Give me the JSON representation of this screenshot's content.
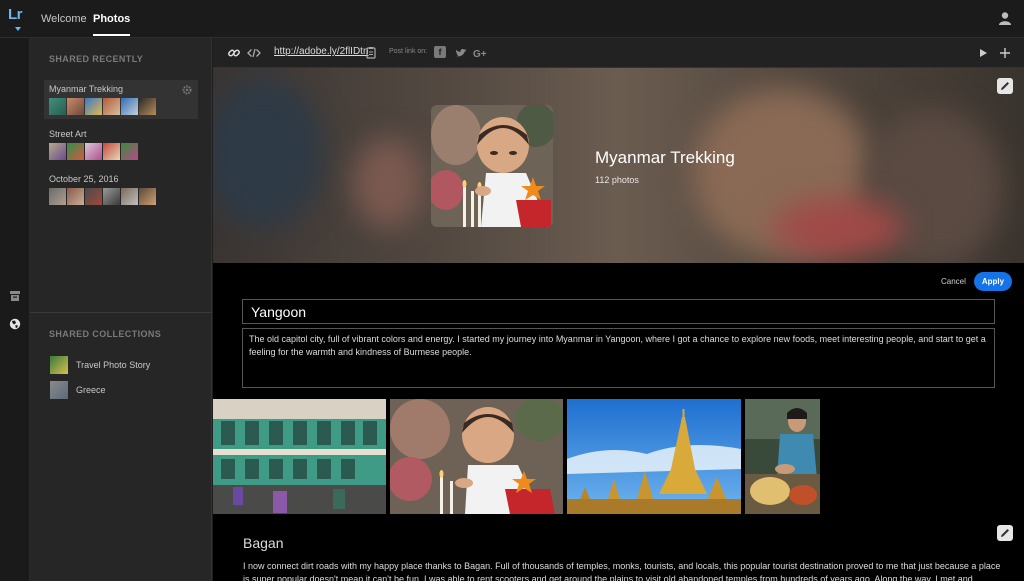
{
  "app": {
    "logo": "Lr"
  },
  "nav": {
    "tabs": [
      {
        "label": "Welcome"
      },
      {
        "label": "Photos"
      }
    ]
  },
  "sidebar": {
    "shared_recently_title": "SHARED RECENTLY",
    "albums": [
      {
        "name": "Myanmar Trekking",
        "selected": true
      },
      {
        "name": "Street Art"
      },
      {
        "name": "October 25, 2016"
      }
    ],
    "shared_collections_title": "SHARED COLLECTIONS",
    "collections": [
      {
        "name": "Travel Photo Story"
      },
      {
        "name": "Greece"
      }
    ]
  },
  "linkbar": {
    "url": "http://adobe.ly/2flIDtn",
    "post_label": "Post link on:",
    "icons": [
      "link-icon",
      "embed-code-icon",
      "copy-icon",
      "facebook-icon",
      "twitter-icon",
      "google-plus-icon",
      "play-icon",
      "add-icon"
    ]
  },
  "hero": {
    "title": "Myanmar Trekking",
    "photo_count": "112 photos"
  },
  "editor": {
    "cancel_label": "Cancel",
    "apply_label": "Apply",
    "title_value": "Yangoon",
    "body_value": "The old capitol city, full of vibrant colors and energy. I started my journey into Myanmar in Yangoon, where I got a chance to explore new foods, meet interesting people, and start to get a feeling for the warmth and kindness of Burmese people."
  },
  "section2": {
    "title": "Bagan",
    "body": "I now connect dirt roads with my happy place thanks to Bagan. Full of thousands of temples, monks, tourists, and locals, this popular tourist destination proved to me that just because a place is super popular doesn't mean it can't be fun. I was able to rent scooters and get around the plains to visit old abandoned temples from hundreds of years ago. Along the way, I met and"
  },
  "colors": {
    "accent": "#1473e6",
    "logo": "#6db7f0",
    "background": "#000000",
    "sidebar": "#262626"
  }
}
